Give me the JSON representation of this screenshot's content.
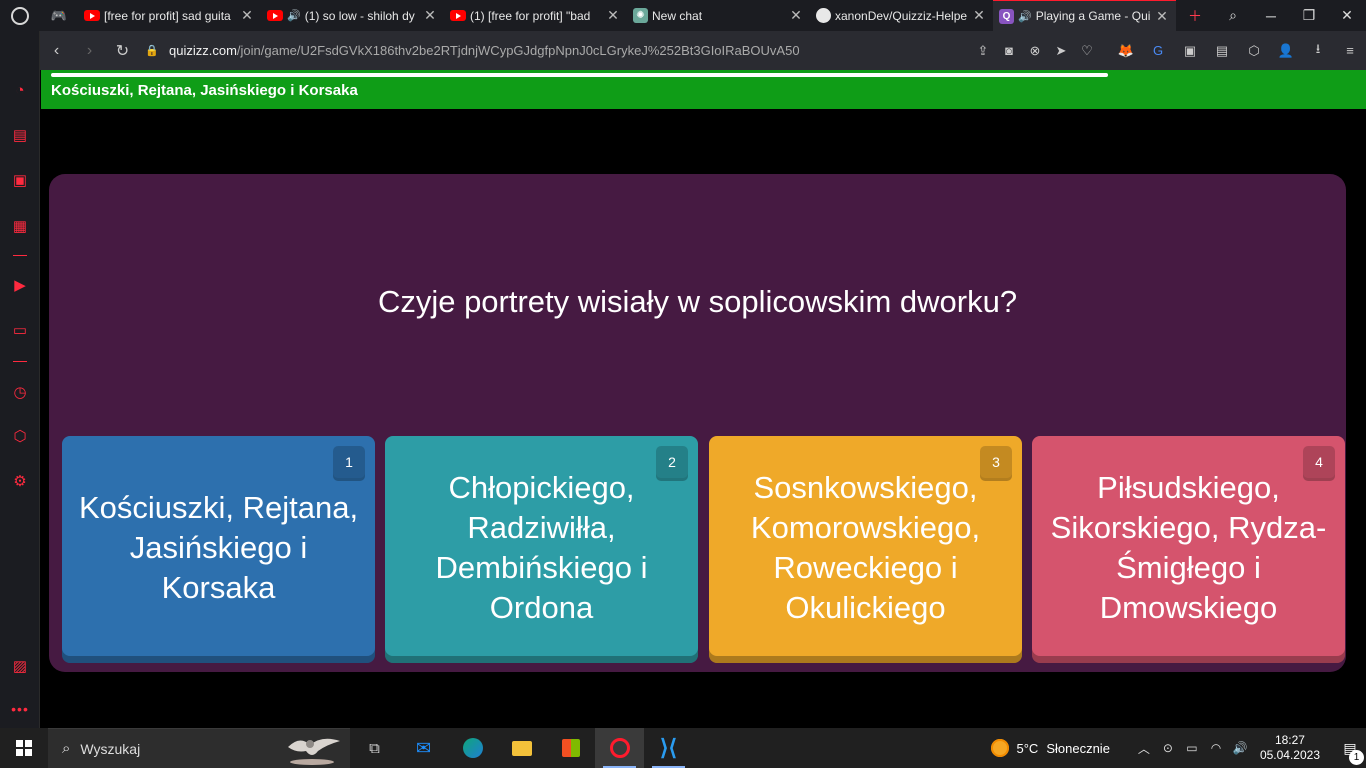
{
  "browser": {
    "tabs": [
      {
        "title": "[free for profit] sad guita",
        "icon": "youtube-icon",
        "audio": false
      },
      {
        "title": "(1) so low - shiloh dy",
        "icon": "youtube-icon",
        "audio": true
      },
      {
        "title": "(1) [free for profit] \"bad",
        "icon": "youtube-icon",
        "audio": false
      },
      {
        "title": "New chat",
        "icon": "chatgpt-icon",
        "audio": false
      },
      {
        "title": "xanonDev/Quizziz-Helpe",
        "icon": "github-icon",
        "audio": false
      },
      {
        "title": "Playing a Game - Qui",
        "icon": "quizizz-icon",
        "audio": true,
        "active": true
      }
    ],
    "address": {
      "domain": "quizizz.com",
      "path": "/join/game/U2FsdGVkX186thv2be2RTjdnjWCypGJdgfpNpnJ0cLGrykeJ%252Bt3GIoIRaBOUvA50"
    },
    "accent": "#ff1b2d"
  },
  "quiz": {
    "progress_fraction": 0.81,
    "correct_answer_banner": "Kościuszki, Rejtana, Jasińskiego i Korsaka",
    "question": "Czyje portrety wisiały w soplicowskim dworku?",
    "options": [
      {
        "number": "1",
        "text": "Kościuszki, Rejtana, Jasińskiego i Korsaka",
        "color": "#2d70ae"
      },
      {
        "number": "2",
        "text": "Chłopickiego, Radziwiłła, Dembińskiego i Ordona",
        "color": "#2d9da6"
      },
      {
        "number": "3",
        "text": "Sosnkowskiego, Komorowskiego, Roweckiego i Okulickiego",
        "color": "#efa929"
      },
      {
        "number": "4",
        "text": "Piłsudskiego, Sikorskiego, Rydza-Śmigłego i Dmowskiego",
        "color": "#d5546d"
      }
    ],
    "colors": {
      "banner": "#0f9d17",
      "card": "#461a42"
    }
  },
  "taskbar": {
    "search_placeholder": "Wyszukaj",
    "weather": {
      "temp": "5°C",
      "condition": "Słonecznie"
    },
    "time": "18:27",
    "date": "05.04.2023",
    "notification_count": "1"
  }
}
